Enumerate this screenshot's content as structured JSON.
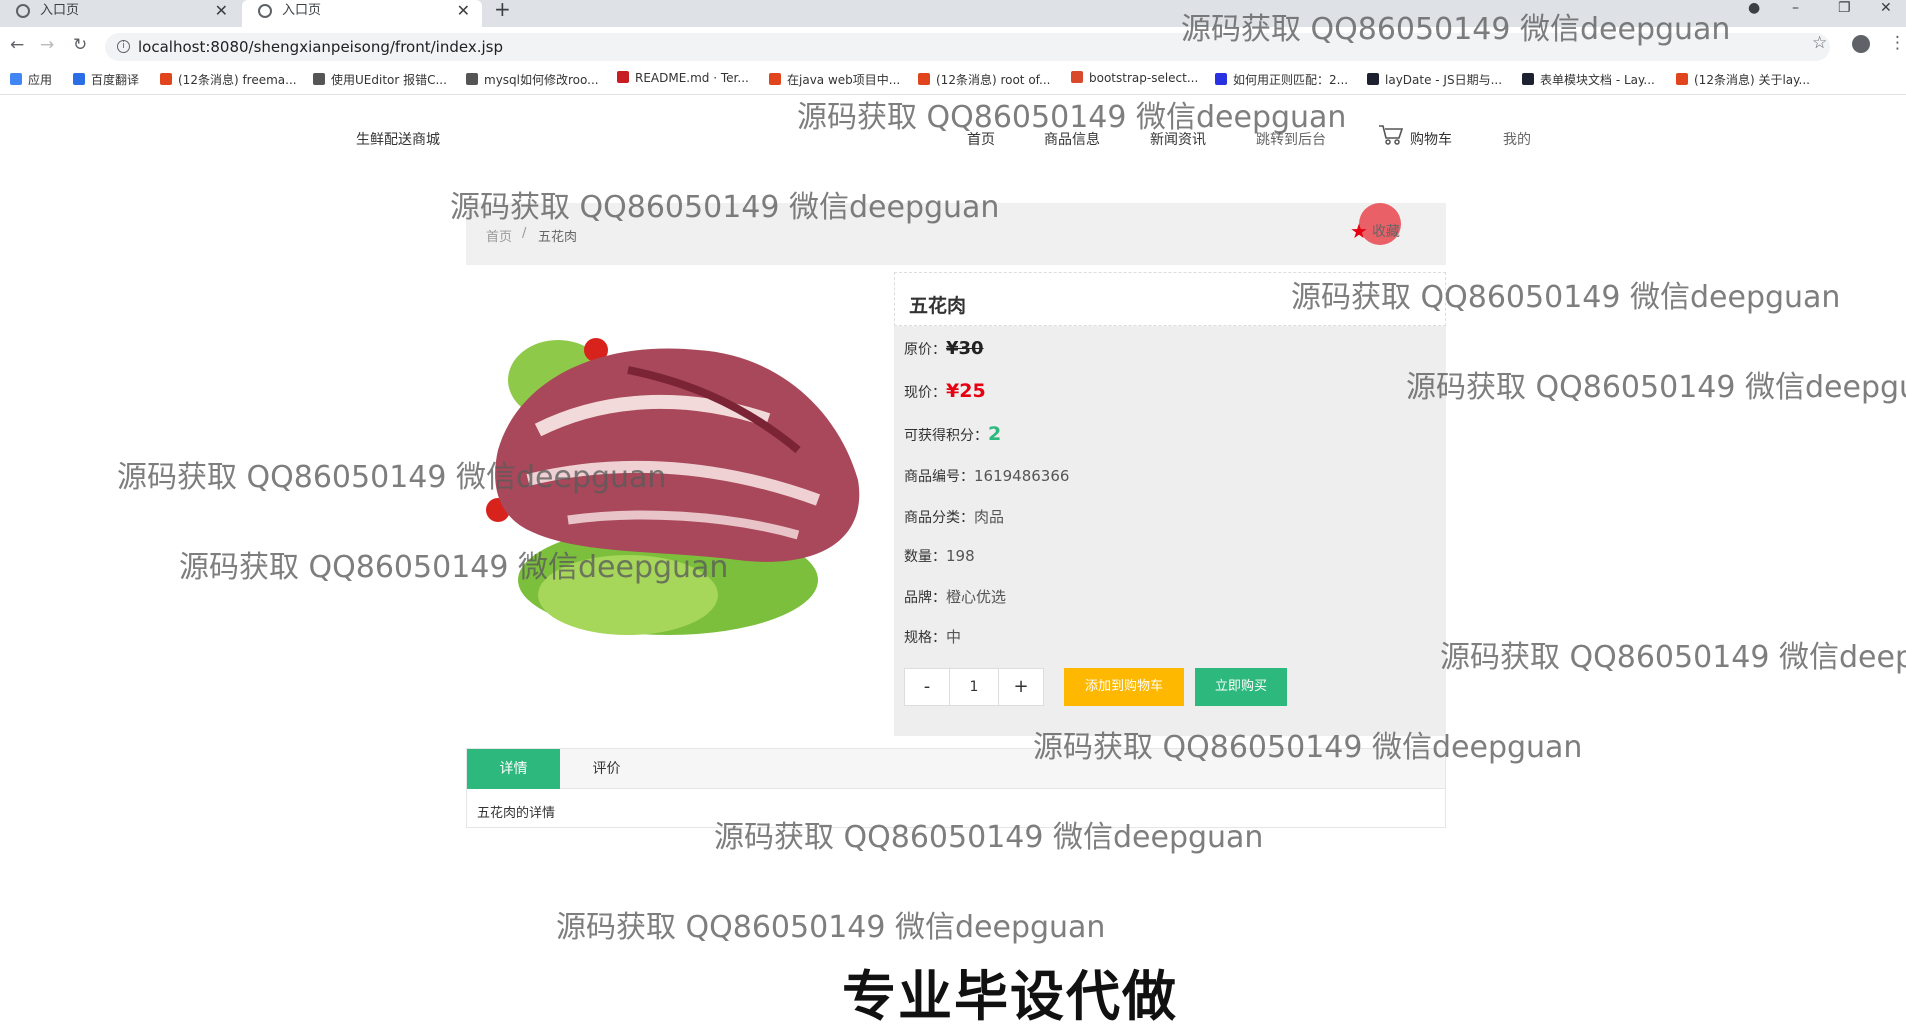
{
  "browser": {
    "tabs": [
      {
        "label": "入口页",
        "active": false
      },
      {
        "label": "入口页",
        "active": true
      }
    ],
    "url": "localhost:8080/shengxianpeisong/front/index.jsp",
    "bookmarks": [
      {
        "label": "应用",
        "color": "#4285f4"
      },
      {
        "label": "百度翻译",
        "color": "#2b6de5"
      },
      {
        "label": "(12条消息) freema...",
        "color": "#e0451d"
      },
      {
        "label": "使用UEditor 报错C...",
        "color": "#555555"
      },
      {
        "label": "mysql如何修改roo...",
        "color": "#555555"
      },
      {
        "label": "README.md · Ter...",
        "color": "#c71d23"
      },
      {
        "label": "在java web项目中...",
        "color": "#e0451d"
      },
      {
        "label": "(12条消息) root of...",
        "color": "#e0451d"
      },
      {
        "label": "bootstrap-select...",
        "color": "#d84a2b"
      },
      {
        "label": "如何用正则匹配：2...",
        "color": "#2932e1"
      },
      {
        "label": "layDate - JS日期与...",
        "color": "#1e2130"
      },
      {
        "label": "表单模块文档 - Lay...",
        "color": "#1e2130"
      },
      {
        "label": "(12条消息) 关于lay...",
        "color": "#e0451d"
      }
    ]
  },
  "header": {
    "site_title": "生鲜配送商城",
    "nav": [
      "首页",
      "商品信息",
      "新闻资讯",
      "跳转到后台",
      "购物车",
      "我的"
    ]
  },
  "breadcrumb": {
    "home": "首页",
    "sep": "/",
    "current": "五花肉",
    "favorite_label": "收藏"
  },
  "product": {
    "name": "五花肉",
    "original_price_label": "原价：",
    "original_price": "¥30",
    "current_price_label": "现价：",
    "current_price": "¥25",
    "points_label": "可获得积分：",
    "points": "2",
    "code_label": "商品编号：",
    "code": "1619486366",
    "category_label": "商品分类：",
    "category": "肉品",
    "quantity_label": "数量：",
    "quantity": "198",
    "brand_label": "品牌：",
    "brand": "橙心优选",
    "spec_label": "规格：",
    "spec": "中",
    "buy_qty": "1",
    "minus": "-",
    "plus": "+",
    "add_to_cart": "添加到购物车",
    "buy_now": "立即购买"
  },
  "detail_tabs": {
    "tabs": [
      "详情",
      "评价"
    ],
    "active": 0,
    "content": "五花肉的详情"
  },
  "overlay": {
    "watermark": "源码获取 QQ86050149 微信deepguan",
    "caption": "专业毕设代做"
  },
  "colors": {
    "accent_green": "#2db87d",
    "accent_orange": "#ffb800",
    "price_red": "#e60012"
  }
}
